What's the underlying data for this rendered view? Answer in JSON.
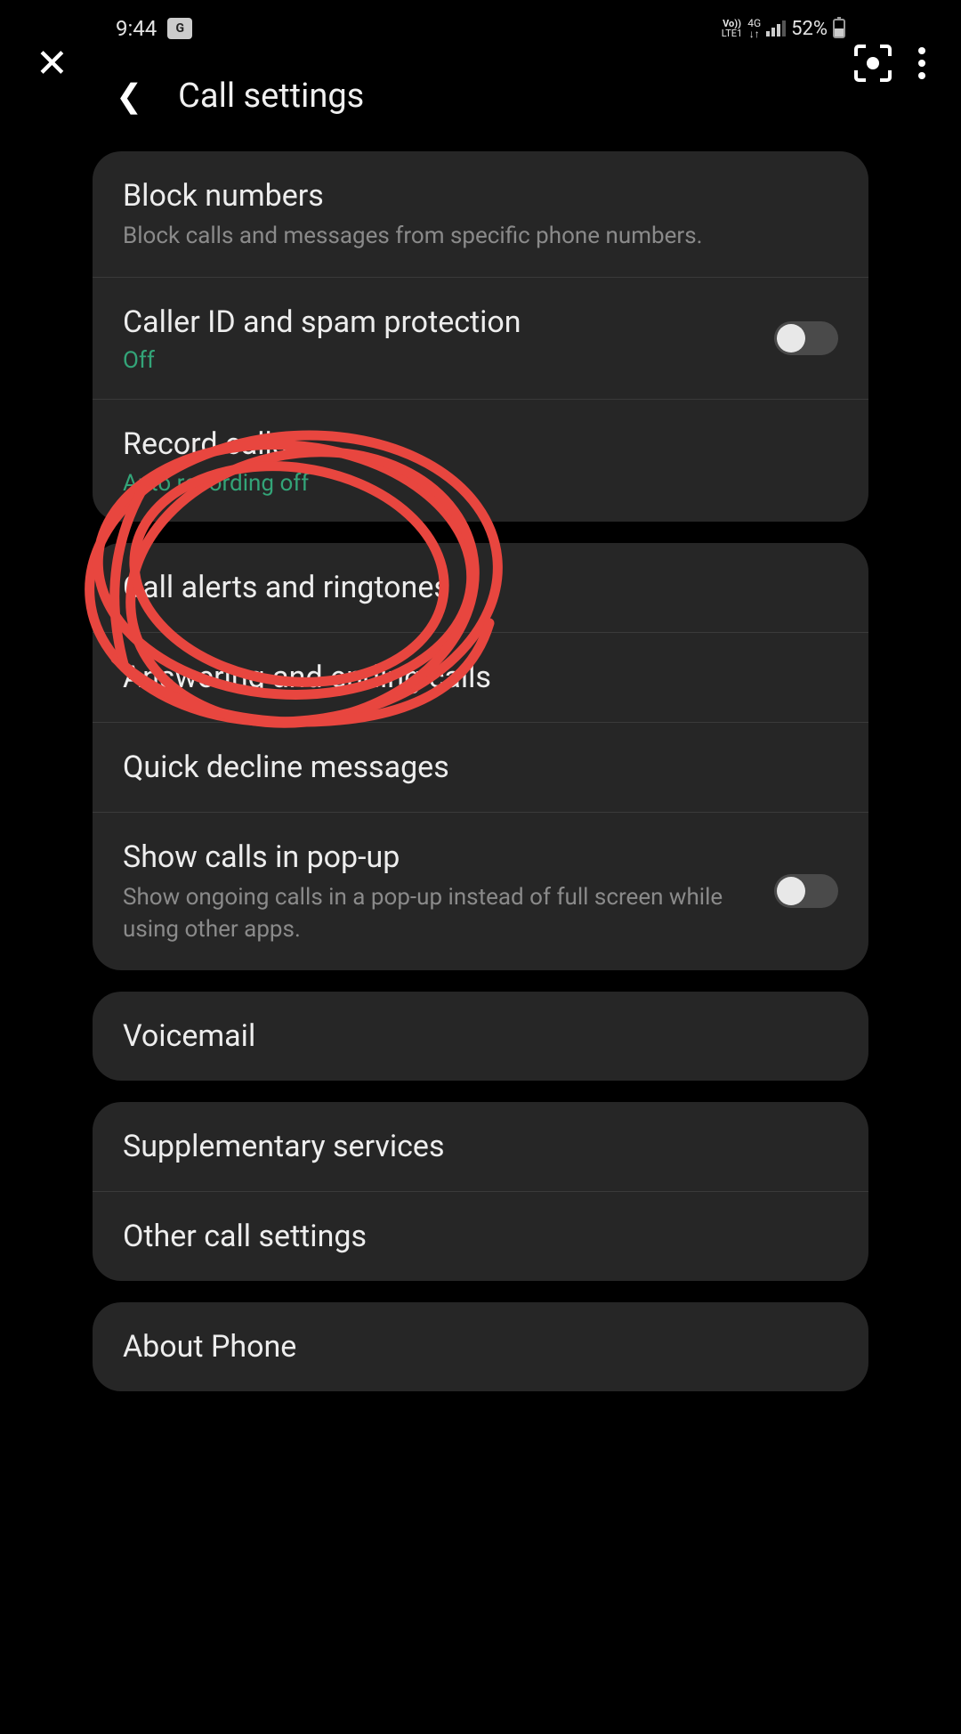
{
  "status": {
    "time": "9:44",
    "volte_top": "Vo))",
    "volte_bot": "LTE1",
    "net_top": "4G",
    "net_bot": "↓↑",
    "battery_pct": "52%"
  },
  "header": {
    "title": "Call settings"
  },
  "group1": {
    "block_title": "Block numbers",
    "block_sub": "Block calls and messages from specific phone numbers.",
    "caller_title": "Caller ID and spam protection",
    "caller_sub": "Off",
    "record_title": "Record calls",
    "record_sub": "Auto recording off"
  },
  "group2": {
    "alerts": "Call alerts and ringtones",
    "answering": "Answering and ending calls",
    "decline": "Quick decline messages",
    "popup_title": "Show calls in pop-up",
    "popup_sub": "Show ongoing calls in a pop-up instead of full screen while using other apps."
  },
  "group3": {
    "voicemail": "Voicemail"
  },
  "group4": {
    "supp": "Supplementary services",
    "other": "Other call settings"
  },
  "group5": {
    "about": "About Phone"
  }
}
